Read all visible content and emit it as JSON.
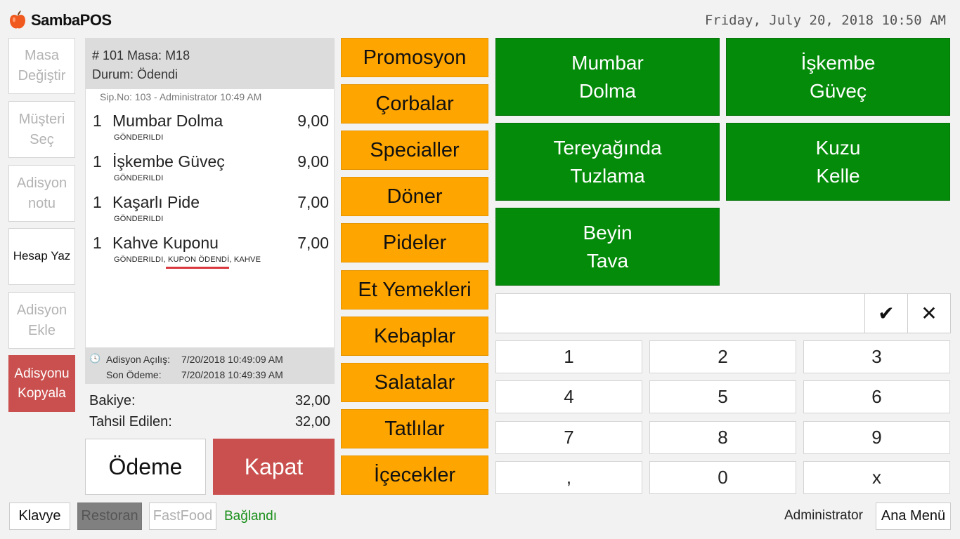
{
  "header": {
    "app_name": "SambaPOS",
    "datetime": "Friday, July 20, 2018 10:50 AM"
  },
  "side_buttons": [
    {
      "label": "Masa\nDeğiştir"
    },
    {
      "label": "Müşteri\nSeç"
    },
    {
      "label": "Adisyon\nnotu"
    },
    {
      "label": "Hesap Yaz"
    },
    {
      "label": "Adisyon\nEkle"
    },
    {
      "label": "Adisyonu\nKopyala"
    }
  ],
  "ticket": {
    "number_line": "# 101 Masa: M18",
    "status_line": "Durum: Ödendi",
    "order_meta": "Sip.No: 103 - Administrator  10:49 AM",
    "items": [
      {
        "qty": "1",
        "name": "Mumbar Dolma",
        "price": "9,00",
        "status": "GÖNDERILDI"
      },
      {
        "qty": "1",
        "name": "İşkembe Güveç",
        "price": "9,00",
        "status": "GÖNDERILDI"
      },
      {
        "qty": "1",
        "name": "Kaşarlı Pide",
        "price": "7,00",
        "status": "GÖNDERILDI"
      },
      {
        "qty": "1",
        "name": "Kahve Kuponu",
        "price": "7,00",
        "status": "GÖNDERILDI, KUPON ÖDENDİ, KAHVE"
      }
    ],
    "opened_label": "Adisyon Açılış:",
    "opened_value": "7/20/2018 10:49:09 AM",
    "last_payment_label": "Son Ödeme:",
    "last_payment_value": "7/20/2018 10:49:39 AM",
    "balance_label": "Bakiye:",
    "balance_value": "32,00",
    "collected_label": "Tahsil Edilen:",
    "collected_value": "32,00",
    "payment_button": "Ödeme",
    "close_button": "Kapat"
  },
  "categories": [
    "Promosyon",
    "Çorbalar",
    "Specialler",
    "Döner",
    "Pideler",
    "Et Yemekleri",
    "Kebaplar",
    "Salatalar",
    "Tatlılar",
    "İçecekler"
  ],
  "products": [
    {
      "label": "Mumbar\nDolma"
    },
    {
      "label": "İşkembe\nGüveç"
    },
    {
      "label": "Tereyağında\nTuzlama"
    },
    {
      "label": "Kuzu\nKelle"
    },
    {
      "label": "Beyin\nTava"
    }
  ],
  "numpad": {
    "input_value": "",
    "confirm_icon": "✔",
    "cancel_icon": "✕",
    "keys": [
      "1",
      "2",
      "3",
      "4",
      "5",
      "6",
      "7",
      "8",
      "9",
      ",",
      "0",
      "x"
    ]
  },
  "bottom_bar": {
    "keyboard_button": "Klavye",
    "restaurant_button": "Restoran",
    "fastfood_button": "FastFood",
    "connection_status": "Bağlandı",
    "user": "Administrator",
    "main_menu_button": "Ana Menü"
  },
  "colors": {
    "category": "#ffa500",
    "product": "#058b0a",
    "close_button": "#c9504e",
    "connected": "#1a8f1a"
  }
}
